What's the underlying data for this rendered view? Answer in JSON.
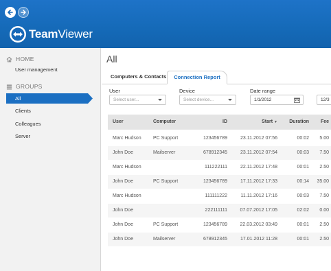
{
  "header": {
    "logo_team": "Team",
    "logo_viewer": "Viewer",
    "colors": {
      "header_bg": "#1668b8",
      "accent": "#1b6fc2",
      "active_item": "#1b6fc2"
    }
  },
  "sidebar": {
    "home_label": "HOME",
    "user_management": "User management",
    "groups_label": "GROUPS",
    "groups": [
      "All",
      "Clients",
      "Colleagues",
      "Server"
    ],
    "selected": "All"
  },
  "main": {
    "title": "All",
    "tabs": [
      {
        "label": "Computers & Contacts",
        "active": false
      },
      {
        "label": "Connection Report",
        "active": true
      }
    ],
    "filters": {
      "user_label": "User",
      "user_placeholder": "Select user...",
      "device_label": "Device",
      "device_placeholder": "Select device...",
      "date_label": "Date range",
      "date_from": "1/1/2012",
      "date_to": "12/3"
    },
    "table": {
      "columns": [
        "User",
        "Computer",
        "ID",
        "Start",
        "Duration",
        "Fee"
      ],
      "sort_indicator": "▼",
      "rows": [
        [
          "Marc Hudson",
          "PC Support",
          "123456789",
          "23.11.2012 07:56",
          "00:02",
          "5.00"
        ],
        [
          "John Doe",
          "Mailserver",
          "678912345",
          "23.11.2012 07:54",
          "00:03",
          "7.50"
        ],
        [
          "Marc Hudson",
          "",
          "111222111",
          "22.11.2012 17:48",
          "00:01",
          "2.50"
        ],
        [
          "John Doe",
          "PC Support",
          "123456789",
          "17.11.2012 17:33",
          "00:14",
          "35.00"
        ],
        [
          "Marc Hudson",
          "",
          "111111222",
          "11.11.2012 17:16",
          "00:03",
          "7.50"
        ],
        [
          "John Doe",
          "",
          "222111111",
          "07.07.2012 17:05",
          "02:02",
          "0.00"
        ],
        [
          "John Doe",
          "PC Support",
          "123456789",
          "22.03.2012 03:49",
          "00:01",
          "2.50"
        ],
        [
          "John Doe",
          "Mailserver",
          "678912345",
          "17.01.2012 11:28",
          "00:01",
          "2.50"
        ]
      ]
    }
  }
}
